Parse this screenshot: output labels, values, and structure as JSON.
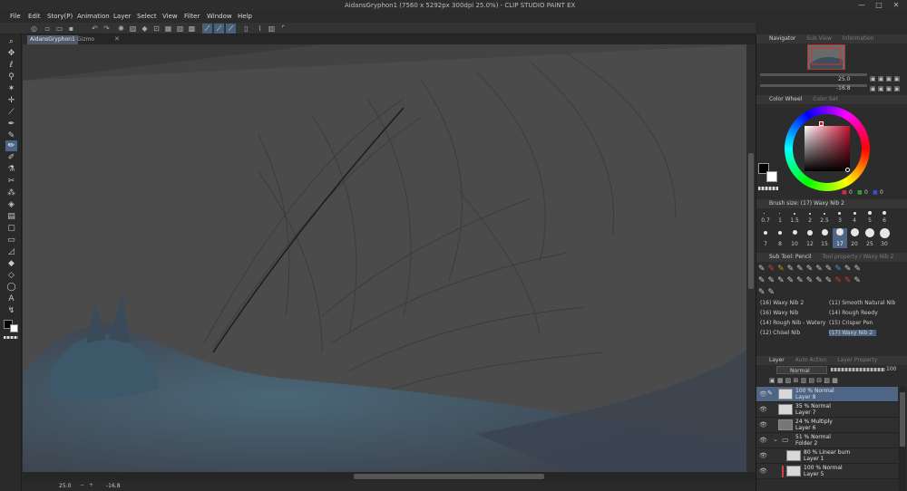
{
  "window": {
    "title": "AidansGryphon1 (7560 x 5292px 300dpi 25.0%) - CLIP STUDIO PAINT EX",
    "controls": [
      "—",
      "□",
      "✕"
    ]
  },
  "menu": [
    "File",
    "Edit",
    "Story(P)",
    "Animation",
    "Layer",
    "Select",
    "View",
    "Filter",
    "Window",
    "Help"
  ],
  "tabs": [
    {
      "label": "AidansGryphon1"
    },
    {
      "label": "Gizmo"
    }
  ],
  "navigator": {
    "title": "Navigator",
    "dim_tabs": [
      "Sub View",
      "Information"
    ],
    "zoom": "25.0",
    "rotation": "-16.8"
  },
  "color_wheel": {
    "title": "Color Wheel",
    "dim_tab": "Color Set",
    "values": [
      "0",
      "0",
      "0"
    ],
    "main_color": "#000000",
    "sub_color": "#ffffff",
    "sv_hue": "#c8102e"
  },
  "brush_size": {
    "title": "Brush size: (17) Waxy Nib 2",
    "sizes_row1": [
      "0.7",
      "1",
      "1.5",
      "2",
      "2.5",
      "3",
      "4",
      "5",
      "6"
    ],
    "sizes_row2": [
      "7",
      "8",
      "10",
      "12",
      "15",
      "17",
      "20",
      "25",
      "30"
    ],
    "selected": "17"
  },
  "sub_tool": {
    "title": "Sub Tool: Pencil",
    "dim_tab": "Tool property / Waxy Nib 2",
    "brushes": [
      [
        "(16) Waxy Nib 2",
        "(11) Smooth Natural Nib"
      ],
      [
        "(16) Waxy Nib",
        "(14) Rough Reedy"
      ],
      [
        "(14) Rough Nib - Watery",
        "(15) Crisper Pen"
      ],
      [
        "(12) Chisel Nib",
        "(17) Waxy Nib 2"
      ]
    ]
  },
  "layers": {
    "title": "Layer",
    "dim_tabs": [
      "Auto Action",
      "Layer Property"
    ],
    "blend_mode": "Normal",
    "opacity": "100",
    "rows": [
      {
        "mode": "100 % Normal",
        "name": "Layer 8",
        "selected": true,
        "indent": 0
      },
      {
        "mode": "35 % Normal",
        "name": "Layer 7",
        "selected": false,
        "indent": 0
      },
      {
        "mode": "24 % Multiply",
        "name": "Layer 6",
        "selected": false,
        "indent": 0
      },
      {
        "mode": "51 % Normal",
        "name": "Folder 2",
        "selected": false,
        "indent": 0,
        "folder": true
      },
      {
        "mode": "80 % Linear burn",
        "name": "Layer 1",
        "selected": false,
        "indent": 1
      },
      {
        "mode": "100 % Normal",
        "name": "Layer 5",
        "selected": false,
        "indent": 1
      }
    ]
  },
  "status": {
    "zoom": "25.0",
    "rotation": "-16.8"
  }
}
